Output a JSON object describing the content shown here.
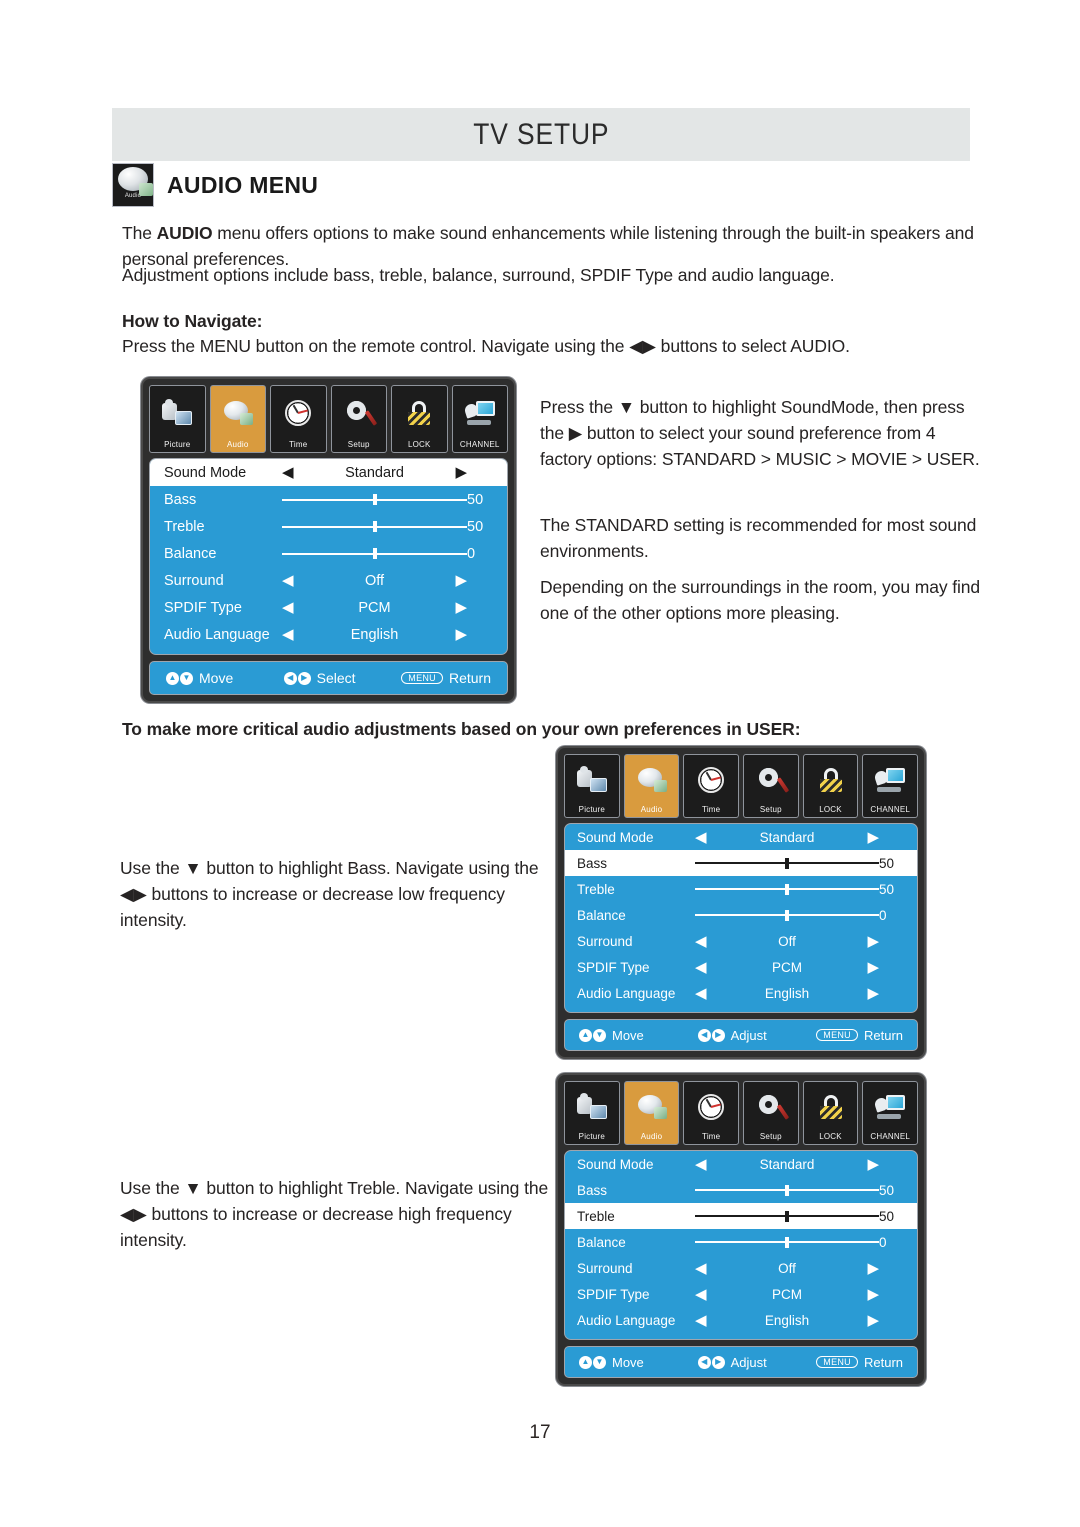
{
  "header": {
    "title": "TV SETUP"
  },
  "section": {
    "icon_label": "Audio",
    "title": "AUDIO MENU"
  },
  "intro": {
    "line1_a": "The ",
    "line1_b": "AUDIO",
    "line1_c": " menu offers options to make sound enhancements while listening through the built-in speakers and personal preferences.",
    "line2": "Adjustment options include bass, treble, balance, surround, SPDIF Type and audio language."
  },
  "navigate": {
    "heading": "How to Navigate:",
    "text": "Press the MENU button on the remote control. Navigate using the ◀▶ buttons to select AUDIO."
  },
  "right_notes": {
    "p1": "Press the ▼ button to highlight SoundMode, then press the ▶ button to select your sound preference from 4 factory options: STANDARD > MUSIC > MOVIE > USER.",
    "p2": "The STANDARD setting is recommended for most sound environments.",
    "p3": "Depending on the surroundings in the room, you may find one of the other options more pleasing."
  },
  "user_heading": "To make more critical audio adjustments based on your own preferences in USER:",
  "bass_note": "Use the ▼ button to highlight Bass. Navigate using the ◀▶ buttons to increase or decrease low frequency intensity.",
  "treble_note": "Use the ▼ button to highlight Treble. Navigate using the ◀▶ buttons to increase or decrease high frequency intensity.",
  "osd_tabs": [
    {
      "label": "Picture",
      "icon": "camera-picture-icon",
      "active": false
    },
    {
      "label": "Audio",
      "icon": "speaker-audio-icon",
      "active": true
    },
    {
      "label": "Time",
      "icon": "clock-time-icon",
      "active": false
    },
    {
      "label": "Setup",
      "icon": "gear-setup-icon",
      "active": false
    },
    {
      "label": "LOCK",
      "icon": "padlock-lock-icon",
      "active": false
    },
    {
      "label": "CHANNEL",
      "icon": "satellite-channel-icon",
      "active": false
    }
  ],
  "osd_rows": {
    "sound_mode": {
      "label": "Sound Mode",
      "value": "Standard",
      "type": "select"
    },
    "bass": {
      "label": "Bass",
      "value": "50",
      "type": "slider",
      "percent": 50
    },
    "treble": {
      "label": "Treble",
      "value": "50",
      "type": "slider",
      "percent": 50
    },
    "balance": {
      "label": "Balance",
      "value": "0",
      "type": "slider",
      "percent": 50
    },
    "surround": {
      "label": "Surround",
      "value": "Off",
      "type": "select"
    },
    "spdif_type": {
      "label": "SPDIF Type",
      "value": "PCM",
      "type": "select"
    },
    "audio_language": {
      "label": "Audio Language",
      "value": "English",
      "type": "select"
    }
  },
  "osd_footers": {
    "menu1": {
      "move": "Move",
      "action": "Select",
      "menu_key": "MENU",
      "return": "Return"
    },
    "menu2": {
      "move": "Move",
      "action": "Adjust",
      "menu_key": "MENU",
      "return": "Return"
    },
    "menu3": {
      "move": "Move",
      "action": "Adjust",
      "menu_key": "MENU",
      "return": "Return"
    }
  },
  "highlighted": {
    "menu1": "Sound Mode",
    "menu2": "Bass",
    "menu3": "Treble"
  },
  "arrows": {
    "left": "◀",
    "right": "▶",
    "up": "▲",
    "down": "▼"
  },
  "page_number": "17",
  "colors": {
    "osd_blue": "#2a9bd4",
    "tab_active": "#d99b3e",
    "header_gray": "#e3e6e6",
    "osd_frame": "#2e2e2e"
  }
}
